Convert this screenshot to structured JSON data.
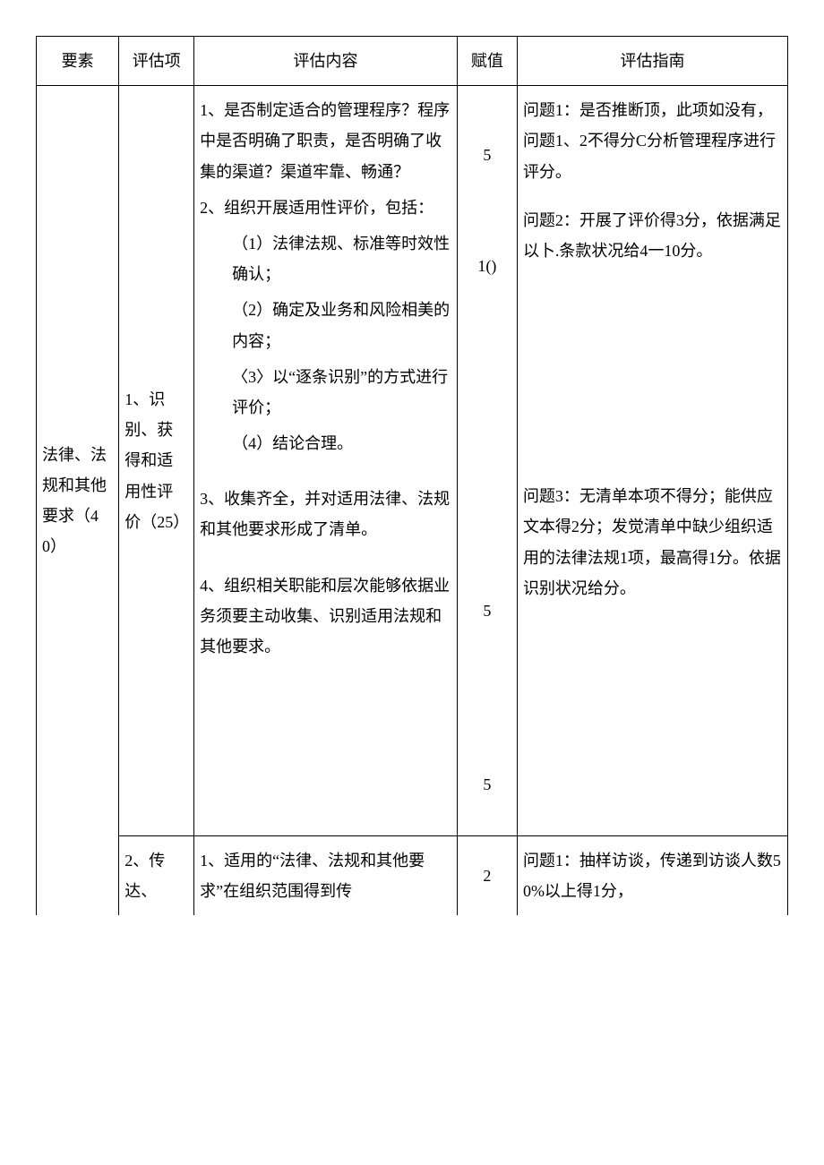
{
  "header": {
    "c1": "要素",
    "c2": "评估项",
    "c3": "评估内容",
    "c4": "赋值",
    "c5": "评估指南"
  },
  "yaosu": "法律、法规和其他要求（40）",
  "row1": {
    "pgx": "1、识别、获得和适用性评价（25）",
    "content": {
      "p1": "1、是否制定适合的管理程序？程序中是否明确了职责，是否明确了收集的渠道？渠道牢靠、畅通？",
      "p2": "2、组织开展适用性评价，包括：",
      "p2a": "（1）法律法规、标准等时效性确认；",
      "p2b": "（2）确定及业务和风险相美的内容；",
      "p2c": "〈3〉以“逐条识别”的方式进行评价；",
      "p2d": "（4）结论合理。",
      "p3": "3、收集齐全，并对适用法律、法规和其他要求形成了清单。",
      "p4": "4、组织相关职能和层次能够依据业务须要主动收集、识别适用法规和其他要求。"
    },
    "scores": {
      "s1": "5",
      "s2": "1()",
      "s3": "5",
      "s4": "5"
    },
    "guide": {
      "g1": "问题1：是否推断顶，此项如没有，问题1、2不得分C分析管理程序进行评分。",
      "g2": "问题2：开展了评价得3分，依据满足以卜.条款状况给4一10分。",
      "g3": "问题3：无清单本项不得分；能供应文本得2分；发觉清单中缺少组织适用的法律法规1项，最高得1分。依据识别状况给分。"
    }
  },
  "row2": {
    "pgx": "2、传达、",
    "content": "1、适用的“法律、法规和其他要求”在组织范围得到传",
    "score": "2",
    "guide": "问题1：抽样访谈，传递到访谈人数50%以上得1分，"
  }
}
